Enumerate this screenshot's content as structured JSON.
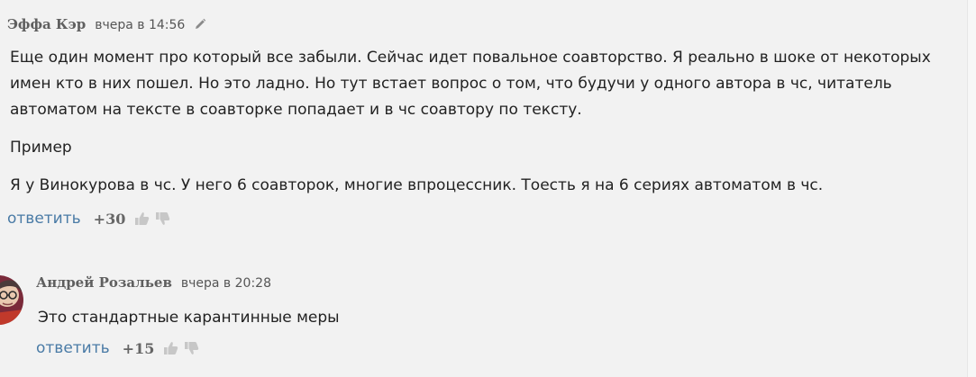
{
  "comments": [
    {
      "author": "Эффа Кэр",
      "time": "вчера в 14:56",
      "paragraphs": [
        "Еще один момент про который все забыли. Сейчас идет повальное соавторство. Я реально в шоке от некоторых имен кто в них пошел. Но это ладно. Но тут встает вопрос о том, что будучи у одного автора в чс, читатель автоматом на тексте в соавторке попадает и в чс соавтору по тексту.",
        "Пример",
        "Я у Винокурова в чс. У него 6 соавторок, многие впроцессник. Тоесть я на 6 сериях автоматом в чс."
      ],
      "reply_label": "ответить",
      "score": "+30",
      "icons": [
        "pencil-icon",
        "thumbs-up-icon",
        "thumbs-down-icon"
      ]
    },
    {
      "author": "Андрей Розальев",
      "time": "вчера в 20:28",
      "paragraphs": [
        "Это стандартные карантинные меры"
      ],
      "reply_label": "ответить",
      "score": "+15",
      "icons": [
        "avatar",
        "thumbs-up-icon",
        "thumbs-down-icon"
      ]
    }
  ],
  "colors": {
    "background": "#f2f2f2",
    "link": "#4a7ba6",
    "author": "#5f5f5f",
    "text": "#222222",
    "vote_icon": "#c7c7c7"
  }
}
